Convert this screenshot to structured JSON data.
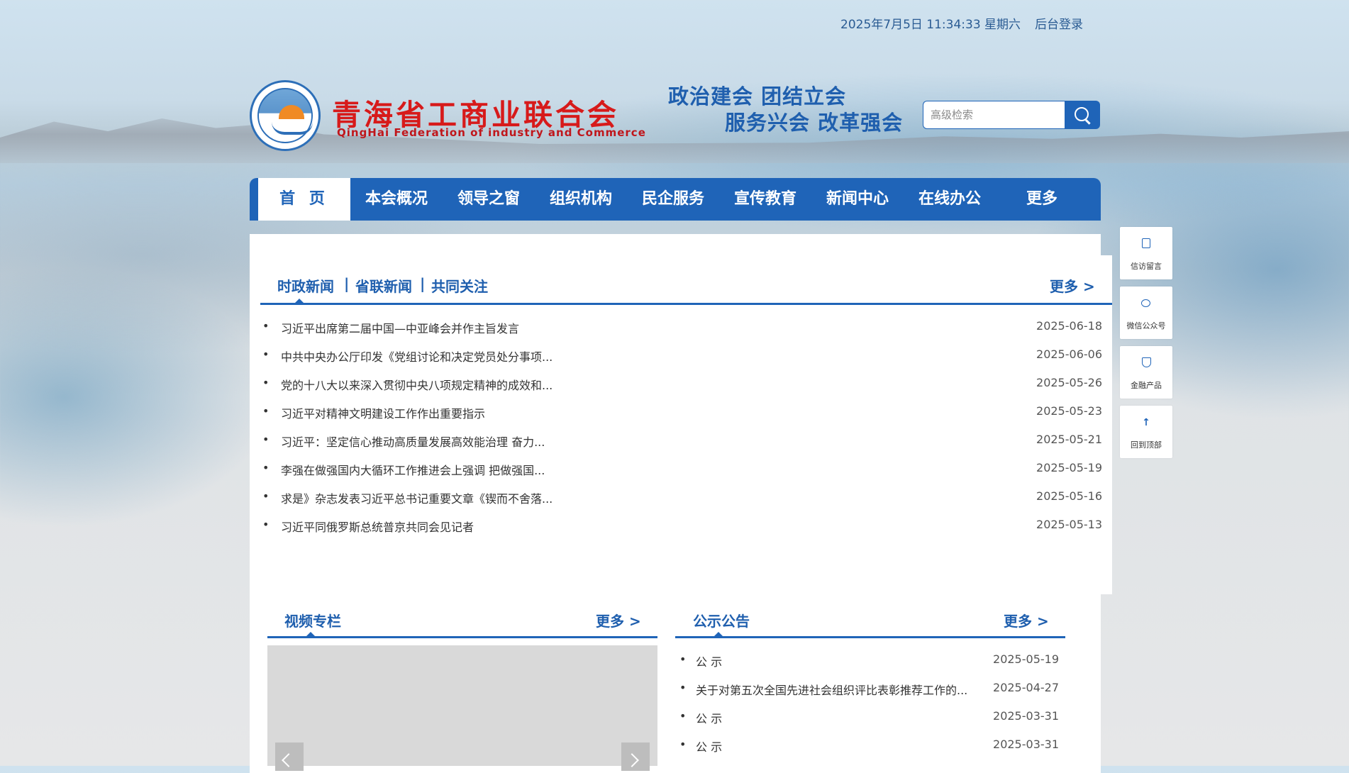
{
  "topbar": {
    "datetime": "2025年7月5日 11:34:33 星期六",
    "login": "后台登录"
  },
  "header": {
    "org_name": "青海省工商业联合会",
    "org_en": "QingHai Federation of industry and Commerce",
    "slogan_line1": "政治建会 团结立会",
    "slogan_line2": "服务兴会 改革强会"
  },
  "search": {
    "placeholder": "高级检索"
  },
  "nav": [
    "首 页",
    "本会概况",
    "领导之窗",
    "组织机构",
    "民企服务",
    "宣传教育",
    "新闻中心",
    "在线办公",
    "更多"
  ],
  "news": {
    "tabs": [
      "时政新闻",
      "省联新闻",
      "共同关注"
    ],
    "separator": "|",
    "more": "更多 >",
    "items": [
      {
        "title": "习近平出席第二届中国—中亚峰会并作主旨发言",
        "date": "2025-06-18"
      },
      {
        "title": "中共中央办公厅印发《党组讨论和决定党员处分事项...",
        "date": "2025-06-06"
      },
      {
        "title": "党的十八大以来深入贯彻中央八项规定精神的成效和...",
        "date": "2025-05-26"
      },
      {
        "title": "习近平对精神文明建设工作作出重要指示",
        "date": "2025-05-23"
      },
      {
        "title": "习近平：坚定信心推动高质量发展高效能治理 奋力...",
        "date": "2025-05-21"
      },
      {
        "title": "李强在做强国内大循环工作推进会上强调 把做强国...",
        "date": "2025-05-19"
      },
      {
        "title": "求是》杂志发表习近平总书记重要文章《锲而不舍落...",
        "date": "2025-05-16"
      },
      {
        "title": "习近平同俄罗斯总统普京共同会见记者",
        "date": "2025-05-13"
      }
    ]
  },
  "video": {
    "title": "视频专栏",
    "more": "更多 >"
  },
  "notice": {
    "title": "公示公告",
    "more": "更多 >",
    "items": [
      {
        "title": "公 示",
        "date": "2025-05-19"
      },
      {
        "title": "关于对第五次全国先进社会组织评比表彰推荐工作的...",
        "date": "2025-04-27"
      },
      {
        "title": "公 示",
        "date": "2025-03-31"
      },
      {
        "title": "公 示",
        "date": "2025-03-31"
      }
    ]
  },
  "side_tools": [
    "信访留言",
    "微信公众号",
    "金融产品",
    "回到顶部"
  ],
  "colors": {
    "primary": "#1f64b8",
    "brand_red": "#d71a1a"
  }
}
